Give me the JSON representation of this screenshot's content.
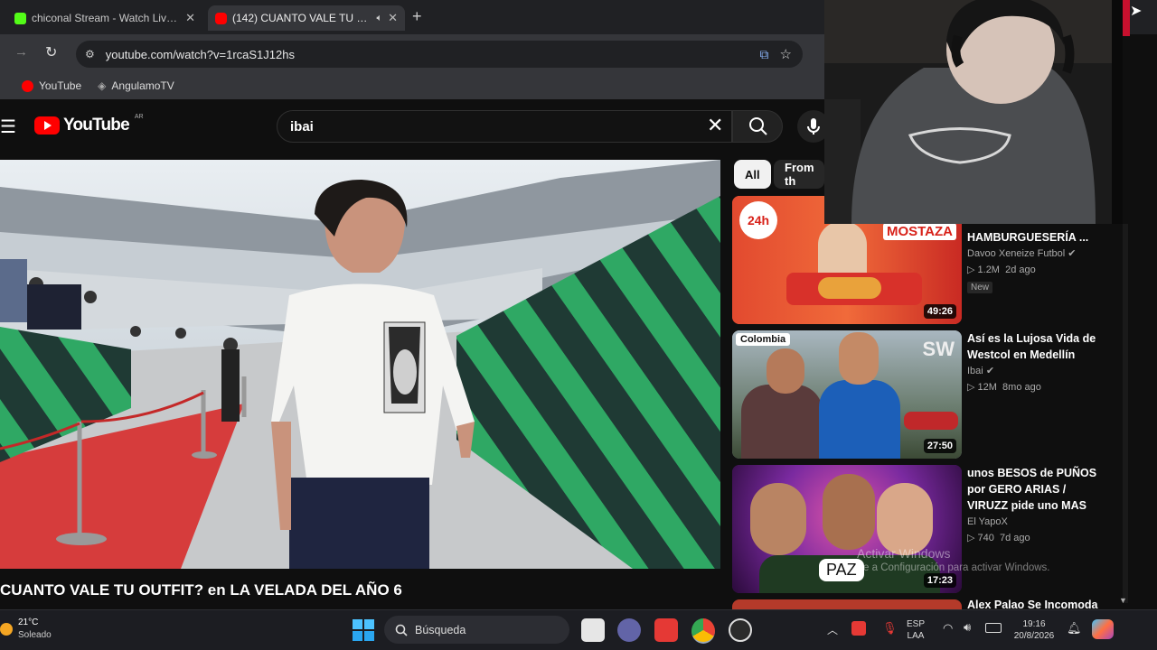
{
  "browser": {
    "tabs": [
      {
        "title": "chiconal Stream - Watch Live o"
      },
      {
        "title": "(142) CUANTO VALE TU OU"
      }
    ],
    "url": "youtube.com/watch?v=1rcaS1J12hs",
    "bookmarks": [
      {
        "label": "YouTube"
      },
      {
        "label": "AngulamoTV"
      }
    ]
  },
  "youtube": {
    "logo_text": "YouTube",
    "logo_sup": "AR",
    "search_value": "ibai",
    "video_title": "CUANTO VALE TU OUTFIT? en LA VELADA DEL AÑO 6",
    "chips": [
      "All",
      "From th"
    ],
    "sidebar": [
      {
        "title_line1": "HAMBURGUESERÍA ...",
        "title_line2": "",
        "channel": "Davoo Xeneize Futbol",
        "views": "1.2M",
        "age": "2d ago",
        "badge": "New",
        "duration": "49:26",
        "thumb_text": "24h",
        "thumb_text2": "MOSTAZA"
      },
      {
        "title_line1": "Así es la Lujosa Vida de",
        "title_line2": "Westcol en Medellín",
        "channel": "Ibai",
        "views": "12M",
        "age": "8mo ago",
        "badge": "",
        "duration": "27:50",
        "thumb_text": "Colombia",
        "thumb_text2": "SW"
      },
      {
        "title_line1": "unos BESOS de PUÑOS",
        "title_line2": "por GERO ARIAS /",
        "title_line3": "VIRUZZ pide uno MAS",
        "channel": "El YapoX",
        "views": "740",
        "age": "7d ago",
        "badge": "",
        "duration": "17:23",
        "thumb_text": "PAZ"
      },
      {
        "title_line1": "Alex Palao Se Incomoda"
      }
    ],
    "activation": {
      "line1": "Activar Windows",
      "line2": "Ve a Configuración para activar Windows."
    }
  },
  "taskbar": {
    "weather_temp": "21°C",
    "weather_desc": "Soleado",
    "search_placeholder": "Búsqueda",
    "lang_top": "ESP",
    "lang_bottom": "LAA",
    "time": "19:16",
    "date": "20/8/2026"
  },
  "colors": {
    "youtube_red": "#ff0000",
    "background": "#0f0f0f",
    "taskbar": "#1c1d22",
    "stadium_green": "#2e8b4f"
  }
}
